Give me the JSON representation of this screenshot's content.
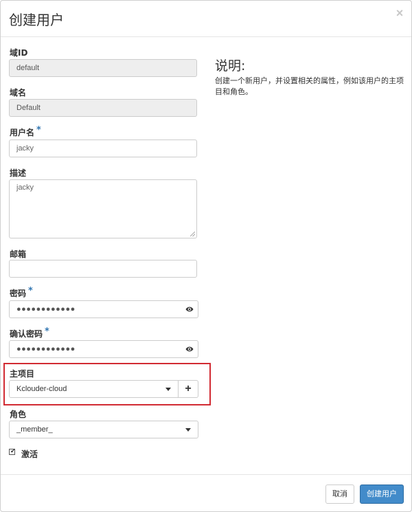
{
  "modal": {
    "title": "创建用户",
    "close_label": "×"
  },
  "form": {
    "domain_id": {
      "label": "域ID",
      "value": "default"
    },
    "domain_name": {
      "label": "域名",
      "value": "Default"
    },
    "username": {
      "label": "用户名",
      "required_mark": "*",
      "value": "jacky"
    },
    "description": {
      "label": "描述",
      "value": "jacky"
    },
    "email": {
      "label": "邮箱",
      "value": ""
    },
    "password": {
      "label": "密码",
      "required_mark": "*",
      "value": "●●●●●●●●●●●●"
    },
    "confirm_password": {
      "label": "确认密码",
      "required_mark": "*",
      "value": "●●●●●●●●●●●●"
    },
    "primary_project": {
      "label": "主项目",
      "selected": "Kclouder-cloud",
      "add_label": "+"
    },
    "role": {
      "label": "角色",
      "selected": "_member_"
    },
    "enabled": {
      "label": "激活",
      "checked": true,
      "check_glyph": "✔"
    }
  },
  "help": {
    "title": "说明:",
    "text": "创建一个新用户，并设置相关的属性，例如该用户的主项目和角色。"
  },
  "footer": {
    "cancel_label": "取消",
    "submit_label": "创建用户"
  },
  "colors": {
    "primary": "#428bca",
    "required": "#3276b1",
    "highlight": "#d12a32"
  },
  "icons": {
    "close": "close-icon",
    "eye": "eye-icon",
    "caret": "chevron-down-icon",
    "plus": "plus-icon",
    "check": "check-icon"
  }
}
